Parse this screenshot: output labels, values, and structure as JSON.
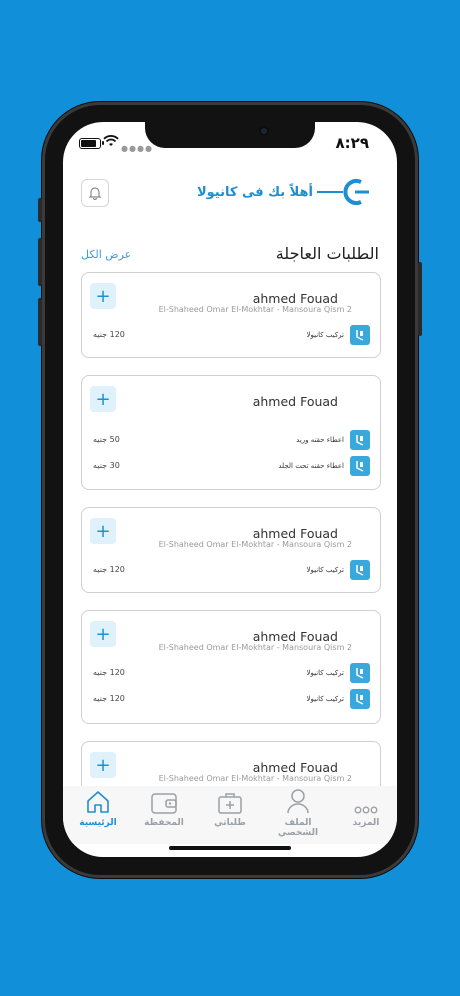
{
  "status_bar": {
    "time": "٨:٢٩"
  },
  "header": {
    "welcome": "أهلاً بك فى كانيولا",
    "bell_icon": "bell-icon",
    "logo_icon": "cannula-logo-icon",
    "brand_color": "#1d8fd0"
  },
  "section": {
    "title": "الطلبات العاجلة",
    "view_all": "عرض الكل"
  },
  "requests": [
    {
      "name": "ahmed Fouad",
      "address": "El-Shaheed Omar El-Mokhtar - Mansoura Qism 2",
      "services": [
        {
          "label": "تركيب كانيولا",
          "price": "120 جنيه"
        }
      ]
    },
    {
      "name": "ahmed Fouad",
      "address": "",
      "services": [
        {
          "label": "اعطاء حقنه وريد",
          "price": "50 جنيه"
        },
        {
          "label": "اعطاء حقنه تحت الجلد",
          "price": "30 جنيه"
        }
      ]
    },
    {
      "name": "ahmed Fouad",
      "address": "El-Shaheed Omar El-Mokhtar - Mansoura Qism 2",
      "services": [
        {
          "label": "تركيب كانيولا",
          "price": "120 جنيه"
        }
      ]
    },
    {
      "name": "ahmed Fouad",
      "address": "El-Shaheed Omar El-Mokhtar - Mansoura Qism 2",
      "services": [
        {
          "label": "تركيب كانيولا",
          "price": "120 جنيه"
        },
        {
          "label": "تركيب كانيولا",
          "price": "120 جنيه"
        }
      ]
    },
    {
      "name": "ahmed Fouad",
      "address": "El-Shaheed Omar El-Mokhtar - Mansoura Qism 2",
      "services": []
    }
  ],
  "tabs": [
    {
      "label": "الرئيسية",
      "icon": "home-icon",
      "active": true
    },
    {
      "label": "المحفظة",
      "icon": "wallet-icon",
      "active": false
    },
    {
      "label": "طلباتي",
      "icon": "medical-bag-icon",
      "active": false
    },
    {
      "label": "الملف الشخصي",
      "icon": "user-icon",
      "active": false
    },
    {
      "label": "المزيد",
      "icon": "more-icon",
      "active": false
    }
  ]
}
